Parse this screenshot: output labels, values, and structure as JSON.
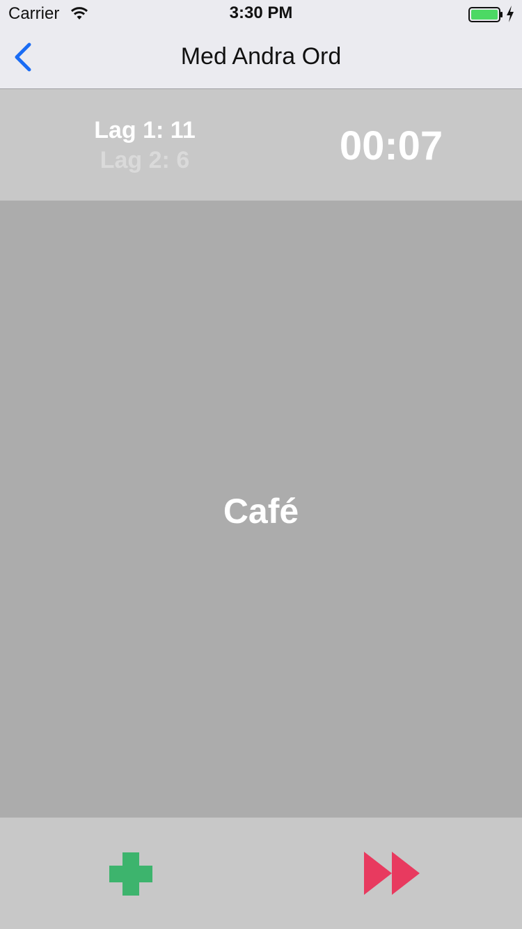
{
  "status_bar": {
    "carrier": "Carrier",
    "time": "3:30 PM",
    "icons": [
      "wifi-icon",
      "battery-icon",
      "charging-bolt-icon"
    ]
  },
  "nav": {
    "back_icon": "chevron-left-icon",
    "title": "Med Andra Ord"
  },
  "score": {
    "team1": "Lag 1: 11",
    "team2": "Lag 2: 6",
    "timer": "00:07"
  },
  "card": {
    "word": "Café"
  },
  "actions": {
    "correct_icon": "plus-icon",
    "skip_icon": "fast-forward-icon"
  },
  "colors": {
    "accent_blue": "#1a6cf4",
    "plus_green": "#3db46d",
    "skip_red": "#e83a5f",
    "battery_green": "#4cd964"
  }
}
